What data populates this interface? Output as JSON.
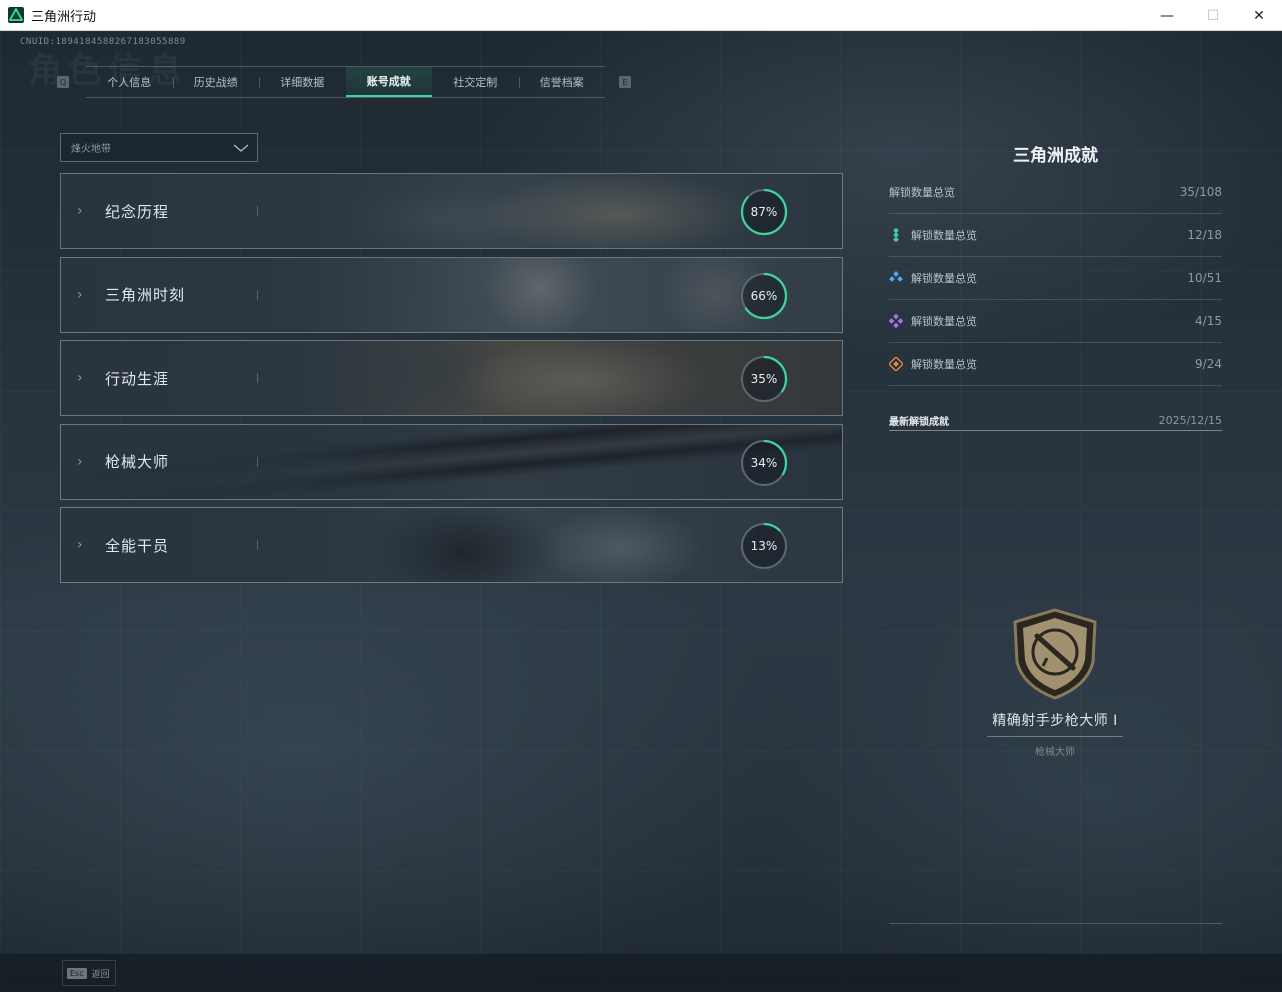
{
  "window": {
    "title": "三角洲行动",
    "minimize": "—",
    "maximize": "☐",
    "close": "✕"
  },
  "uid": "CNUID:1894184588267183055889",
  "ghost_title": "角色信息",
  "tabs": {
    "prev_key": "Q",
    "next_key": "E",
    "items": [
      {
        "label": "个人信息",
        "active": false
      },
      {
        "label": "历史战绩",
        "active": false
      },
      {
        "label": "详细数据",
        "active": false
      },
      {
        "label": "账号成就",
        "active": true
      },
      {
        "label": "社交定制",
        "active": false
      },
      {
        "label": "信誉档案",
        "active": false
      }
    ]
  },
  "filter": {
    "value": "烽火地带"
  },
  "categories": [
    {
      "label": "纪念历程",
      "percent": 87,
      "percent_label": "87%"
    },
    {
      "label": "三角洲时刻",
      "percent": 66,
      "percent_label": "66%"
    },
    {
      "label": "行动生涯",
      "percent": 35,
      "percent_label": "35%"
    },
    {
      "label": "枪械大师",
      "percent": 34,
      "percent_label": "34%"
    },
    {
      "label": "全能干员",
      "percent": 13,
      "percent_label": "13%"
    }
  ],
  "panel": {
    "title": "三角洲成就",
    "stats": [
      {
        "label": "解锁数量总览",
        "value": "35/108",
        "icon": "none",
        "color": ""
      },
      {
        "label": "解锁数量总览",
        "value": "12/18",
        "icon": "green-diamonds-icon",
        "color": "#3ecf9a"
      },
      {
        "label": "解锁数量总览",
        "value": "10/51",
        "icon": "blue-diamonds-icon",
        "color": "#5aa6f0"
      },
      {
        "label": "解锁数量总览",
        "value": "4/15",
        "icon": "purple-diamonds-icon",
        "color": "#a472e8"
      },
      {
        "label": "解锁数量总览",
        "value": "9/24",
        "icon": "orange-diamonds-icon",
        "color": "#e98a44"
      }
    ],
    "latest_label": "最新解锁成就",
    "latest_date": "2025/12/15",
    "badge_name": "精确射手步枪大师 I",
    "badge_category": "枪械大师"
  },
  "bottom": {
    "esc_key": "Esc",
    "esc_label": "返回"
  },
  "colors": {
    "accent": "#3fd29b",
    "ring_track": "#5d676e"
  }
}
